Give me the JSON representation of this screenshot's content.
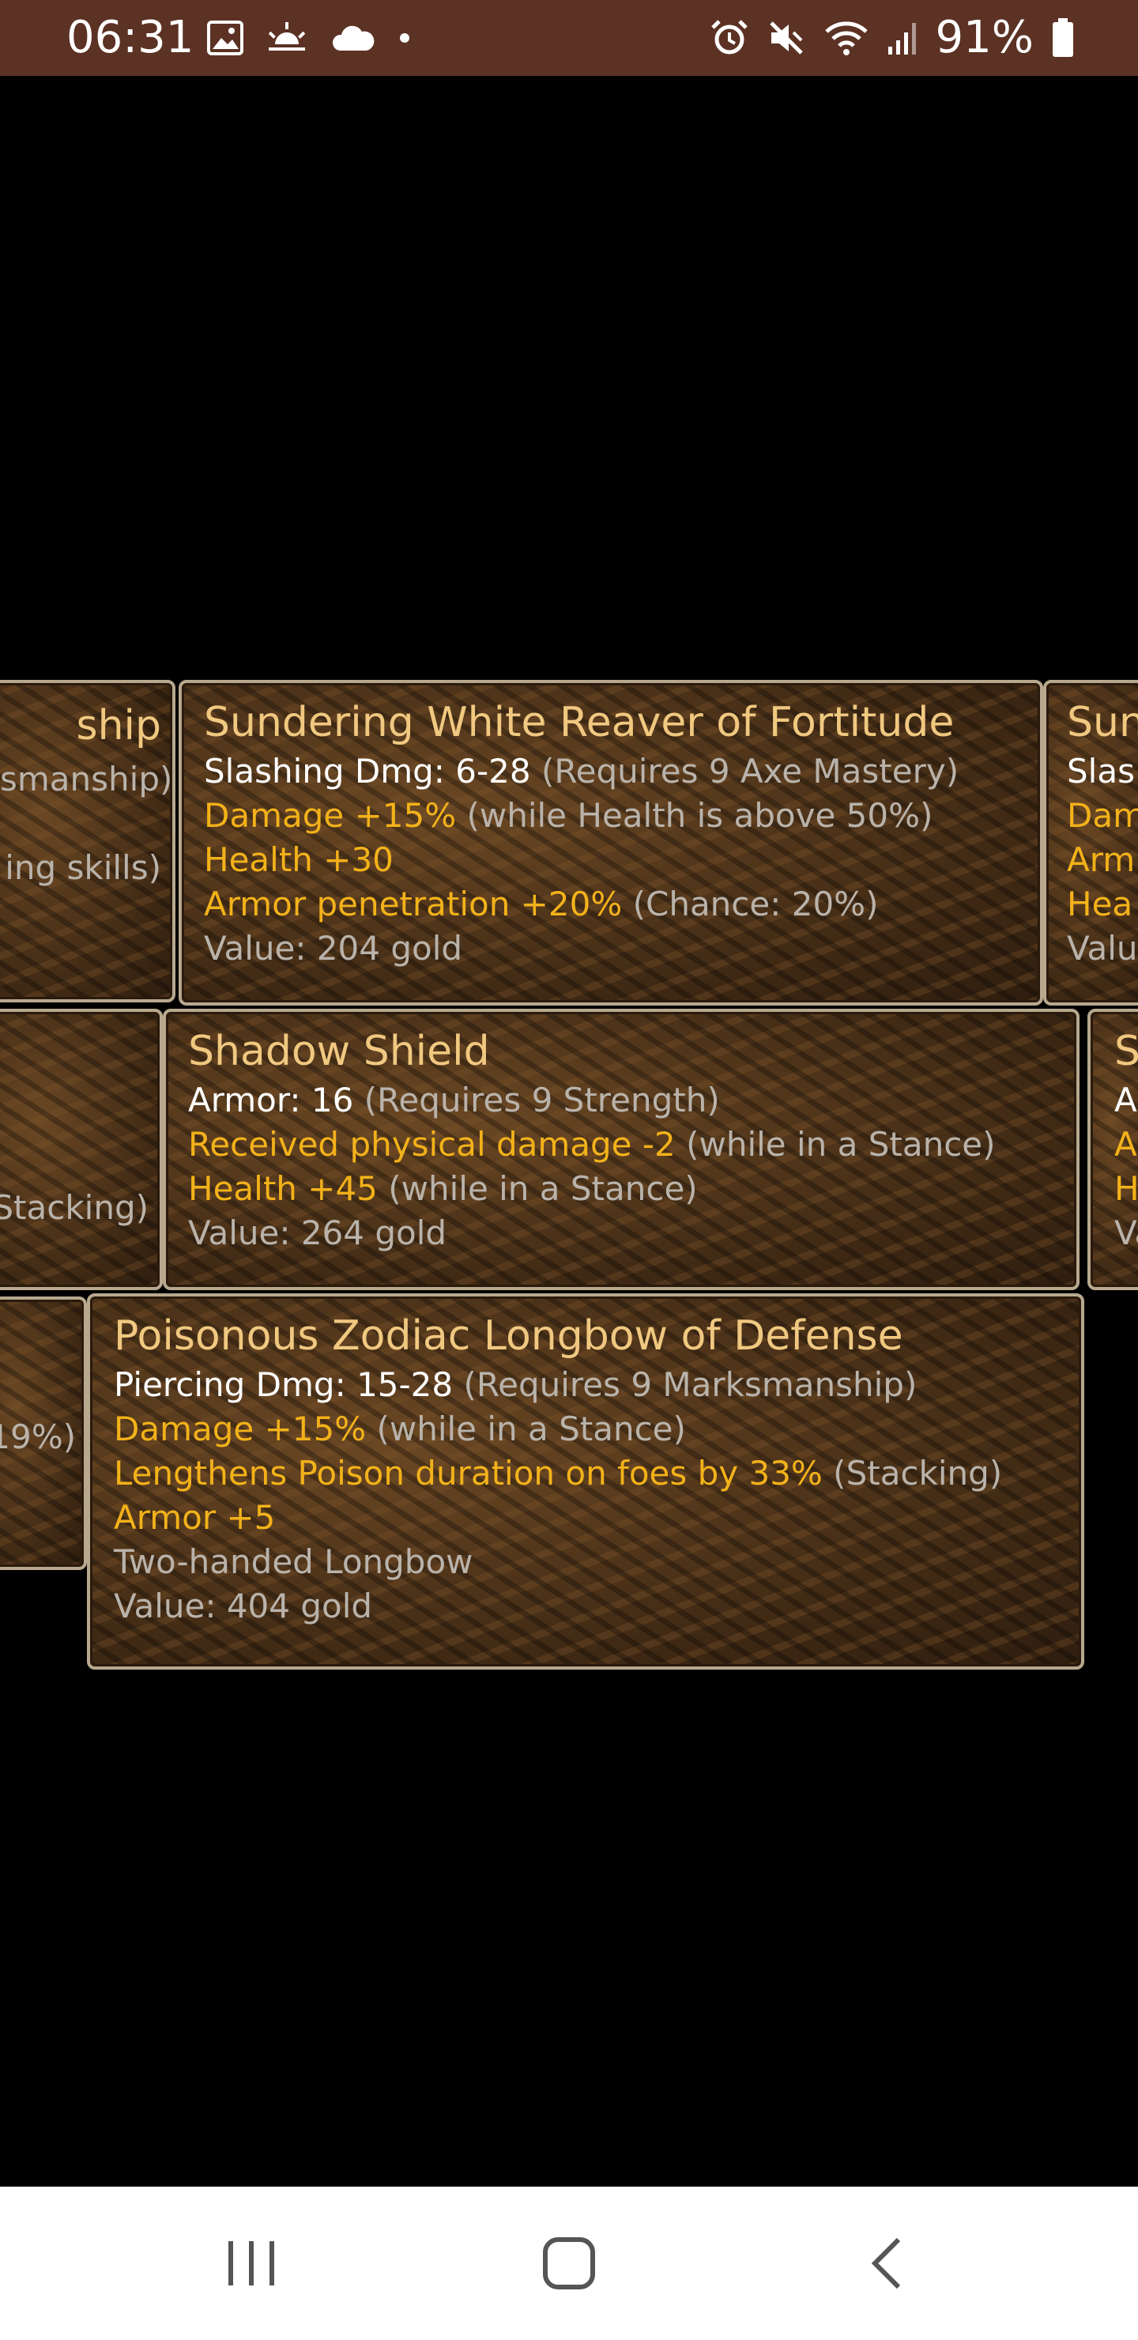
{
  "status_bar": {
    "time": "06:31",
    "battery": "91%",
    "left_icons": [
      "image-icon",
      "weather-sunrise-icon",
      "cloud-icon",
      "dot-icon"
    ],
    "right_icons": [
      "alarm-icon",
      "mute-icon",
      "wifi-icon",
      "signal-icon",
      "battery-icon"
    ]
  },
  "tooltips": {
    "left_col": {
      "a": {
        "line1": "ship",
        "line2": "smanship)",
        "line3": "ing skills)"
      },
      "b": {
        "line1": "Stacking)"
      },
      "c": {
        "line1": "19%)"
      }
    },
    "reaver": {
      "title": "Sundering White Reaver of Fortitude",
      "lines": [
        {
          "label": "Slashing Dmg: 6-28",
          "note": " (Requires 9 Axe Mastery)"
        },
        {
          "label": "Damage +15%",
          "note": " (while Health is above 50%)"
        },
        {
          "label": "Health +30",
          "note": ""
        },
        {
          "label": "Armor penetration +20%",
          "note": " (Chance: 20%)"
        },
        {
          "label": "Value: 204 gold",
          "note": ""
        }
      ]
    },
    "shield": {
      "title": "Shadow Shield",
      "lines": [
        {
          "label": "Armor: 16",
          "note": " (Requires 9 Strength)"
        },
        {
          "label": "Received physical damage -2",
          "note": " (while in a Stance)"
        },
        {
          "label": "Health +45",
          "note": " (while in a Stance)"
        },
        {
          "label": "Value: 264 gold",
          "note": ""
        }
      ]
    },
    "longbow": {
      "title": "Poisonous Zodiac Longbow of Defense",
      "lines": [
        {
          "label": "Piercing Dmg: 15-28",
          "note": " (Requires 9 Marksmanship)"
        },
        {
          "label": "Damage +15%",
          "note": " (while in a Stance)"
        },
        {
          "label": "Lengthens Poison duration on foes by 33%",
          "note": " (Stacking)"
        },
        {
          "label": "Armor +5",
          "note": ""
        },
        {
          "label": "Two-handed Longbow",
          "note": ""
        },
        {
          "label": "Value: 404 gold",
          "note": ""
        }
      ]
    },
    "right_col": {
      "a": {
        "title": "Sun",
        "l1": "Slas",
        "l2": "Dam",
        "l3": "Arm",
        "l4": "Hea",
        "l5": "Valu"
      },
      "b": {
        "title": "Sl",
        "l1": "A",
        "l2": "A",
        "l3": "H",
        "l4": "Va"
      }
    }
  },
  "nav_bar": {
    "buttons": [
      "recent-apps-button",
      "home-button",
      "back-button"
    ]
  },
  "colors": {
    "status_bar_bg": "#5b3224",
    "tooltip_title": "#f0c880",
    "stat_white": "#ffffff",
    "stat_yellow": "#f3b21a",
    "stat_gray": "#b9b3ab",
    "tooltip_border": "#b7a88e"
  }
}
